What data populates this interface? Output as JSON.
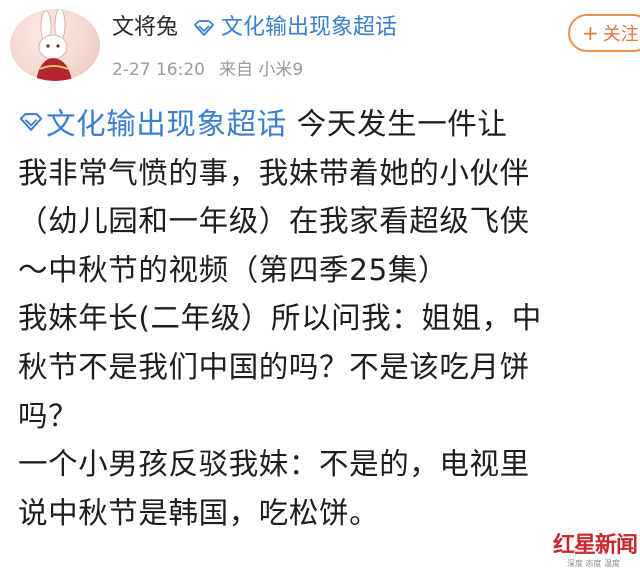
{
  "header": {
    "user_name": "文将兔",
    "topic": "文化输出现象超话",
    "timestamp": "2-27 16:20",
    "source": "来自 小米9",
    "follow_label": "关注",
    "follow_plus": "+"
  },
  "post": {
    "inline_topic": "文化输出现象超话",
    "lines": [
      " 今天发生一件让",
      "我非常气愤的事，我妹带着她的小伙伴",
      "（幼儿园和一年级）在我家看超级飞侠",
      "～中秋节的视频（第四季25集）",
      "我妹年长(二年级）所以问我：姐姐，中",
      "秋节不是我们中国的吗？不是该吃月饼",
      "吗？",
      "一个小男孩反驳我妹：不是的，电视里",
      "说中秋节是韩国，吃松饼。"
    ]
  },
  "watermark": {
    "brand": "红星新闻",
    "sub": "深度 态度 温度"
  },
  "colors": {
    "link": "#3b7fd0",
    "follow": "#e7743a",
    "meta": "#9a9a9a",
    "brand_red": "#c9292e"
  },
  "icons": {
    "topic_icon": "diamond-icon",
    "avatar": "rabbit-avatar"
  }
}
